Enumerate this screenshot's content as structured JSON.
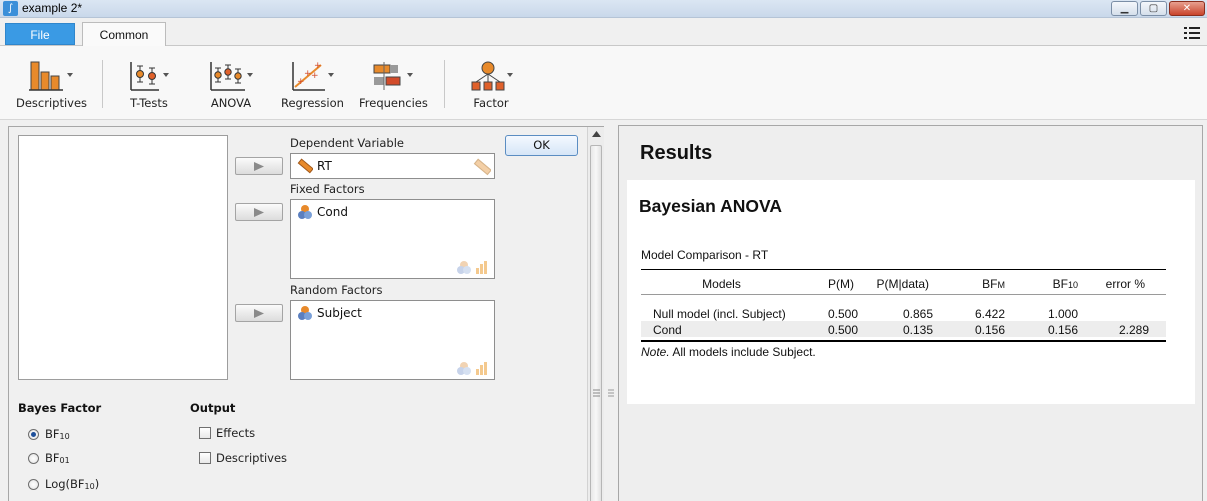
{
  "window": {
    "title": "example 2*"
  },
  "tabs": {
    "file": "File",
    "common": "Common"
  },
  "ribbon": {
    "buttons": [
      {
        "label": "Descriptives",
        "icon": "descriptives-icon"
      },
      {
        "label": "T-Tests",
        "icon": "t-tests-icon"
      },
      {
        "label": "ANOVA",
        "icon": "anova-icon"
      },
      {
        "label": "Regression",
        "icon": "regression-icon"
      },
      {
        "label": "Frequencies",
        "icon": "frequencies-icon"
      },
      {
        "label": "Factor",
        "icon": "factor-icon"
      }
    ]
  },
  "options": {
    "ok_label": "OK",
    "dependent": {
      "label": "Dependent Variable",
      "value": "RT"
    },
    "fixed": {
      "label": "Fixed Factors",
      "items": [
        "Cond"
      ]
    },
    "random": {
      "label": "Random Factors",
      "items": [
        "Subject"
      ]
    },
    "bayes_factor": {
      "heading": "Bayes Factor",
      "options": [
        {
          "main": "BF",
          "sub": "10",
          "suffix": "",
          "selected": true
        },
        {
          "main": "BF",
          "sub": "01",
          "suffix": "",
          "selected": false
        },
        {
          "main": "Log(BF",
          "sub": "10",
          "suffix": ")",
          "selected": false
        }
      ]
    },
    "output": {
      "heading": "Output",
      "options": [
        {
          "label": "Effects",
          "checked": false
        },
        {
          "label": "Descriptives",
          "checked": false
        }
      ]
    }
  },
  "results": {
    "heading": "Results",
    "analysis_title": "Bayesian ANOVA",
    "table_title": "Model Comparison - RT",
    "columns": [
      "Models",
      "P(M)",
      "P(M|data)",
      "BFM",
      "BF10",
      "error %"
    ],
    "col_bfm": {
      "main": "BF",
      "sub": "M"
    },
    "col_bf10": {
      "main": "BF",
      "sub": "10"
    },
    "rows": [
      {
        "model": "Null model (incl. Subject)",
        "pm": "0.500",
        "pmd": "0.865",
        "bfm": "6.422",
        "bf10": "1.000",
        "err": ""
      },
      {
        "model": "Cond",
        "pm": "0.500",
        "pmd": "0.135",
        "bfm": "0.156",
        "bf10": "0.156",
        "err": "2.289"
      }
    ],
    "note_label": "Note.",
    "note_text": " All models include Subject."
  }
}
